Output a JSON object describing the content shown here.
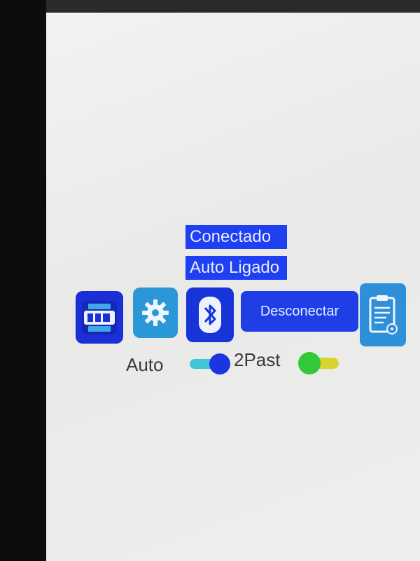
{
  "status": {
    "connection": "Conectado",
    "auto_state": "Auto Ligado"
  },
  "toolbar": {
    "logo_icon": "app-logo-icon",
    "settings_icon": "gear-icon",
    "bluetooth_icon": "bluetooth-icon",
    "disconnect_label": "Desconectar",
    "report_icon": "clipboard-icon"
  },
  "switches": {
    "auto_label": "Auto",
    "auto_on": true,
    "past_label": "2Past",
    "past_on": false
  },
  "colors": {
    "primary_blue": "#1f3ff2",
    "light_blue": "#2c97d6",
    "toggle_green": "#32c83a",
    "toggle_yellow": "#d9d32e"
  }
}
